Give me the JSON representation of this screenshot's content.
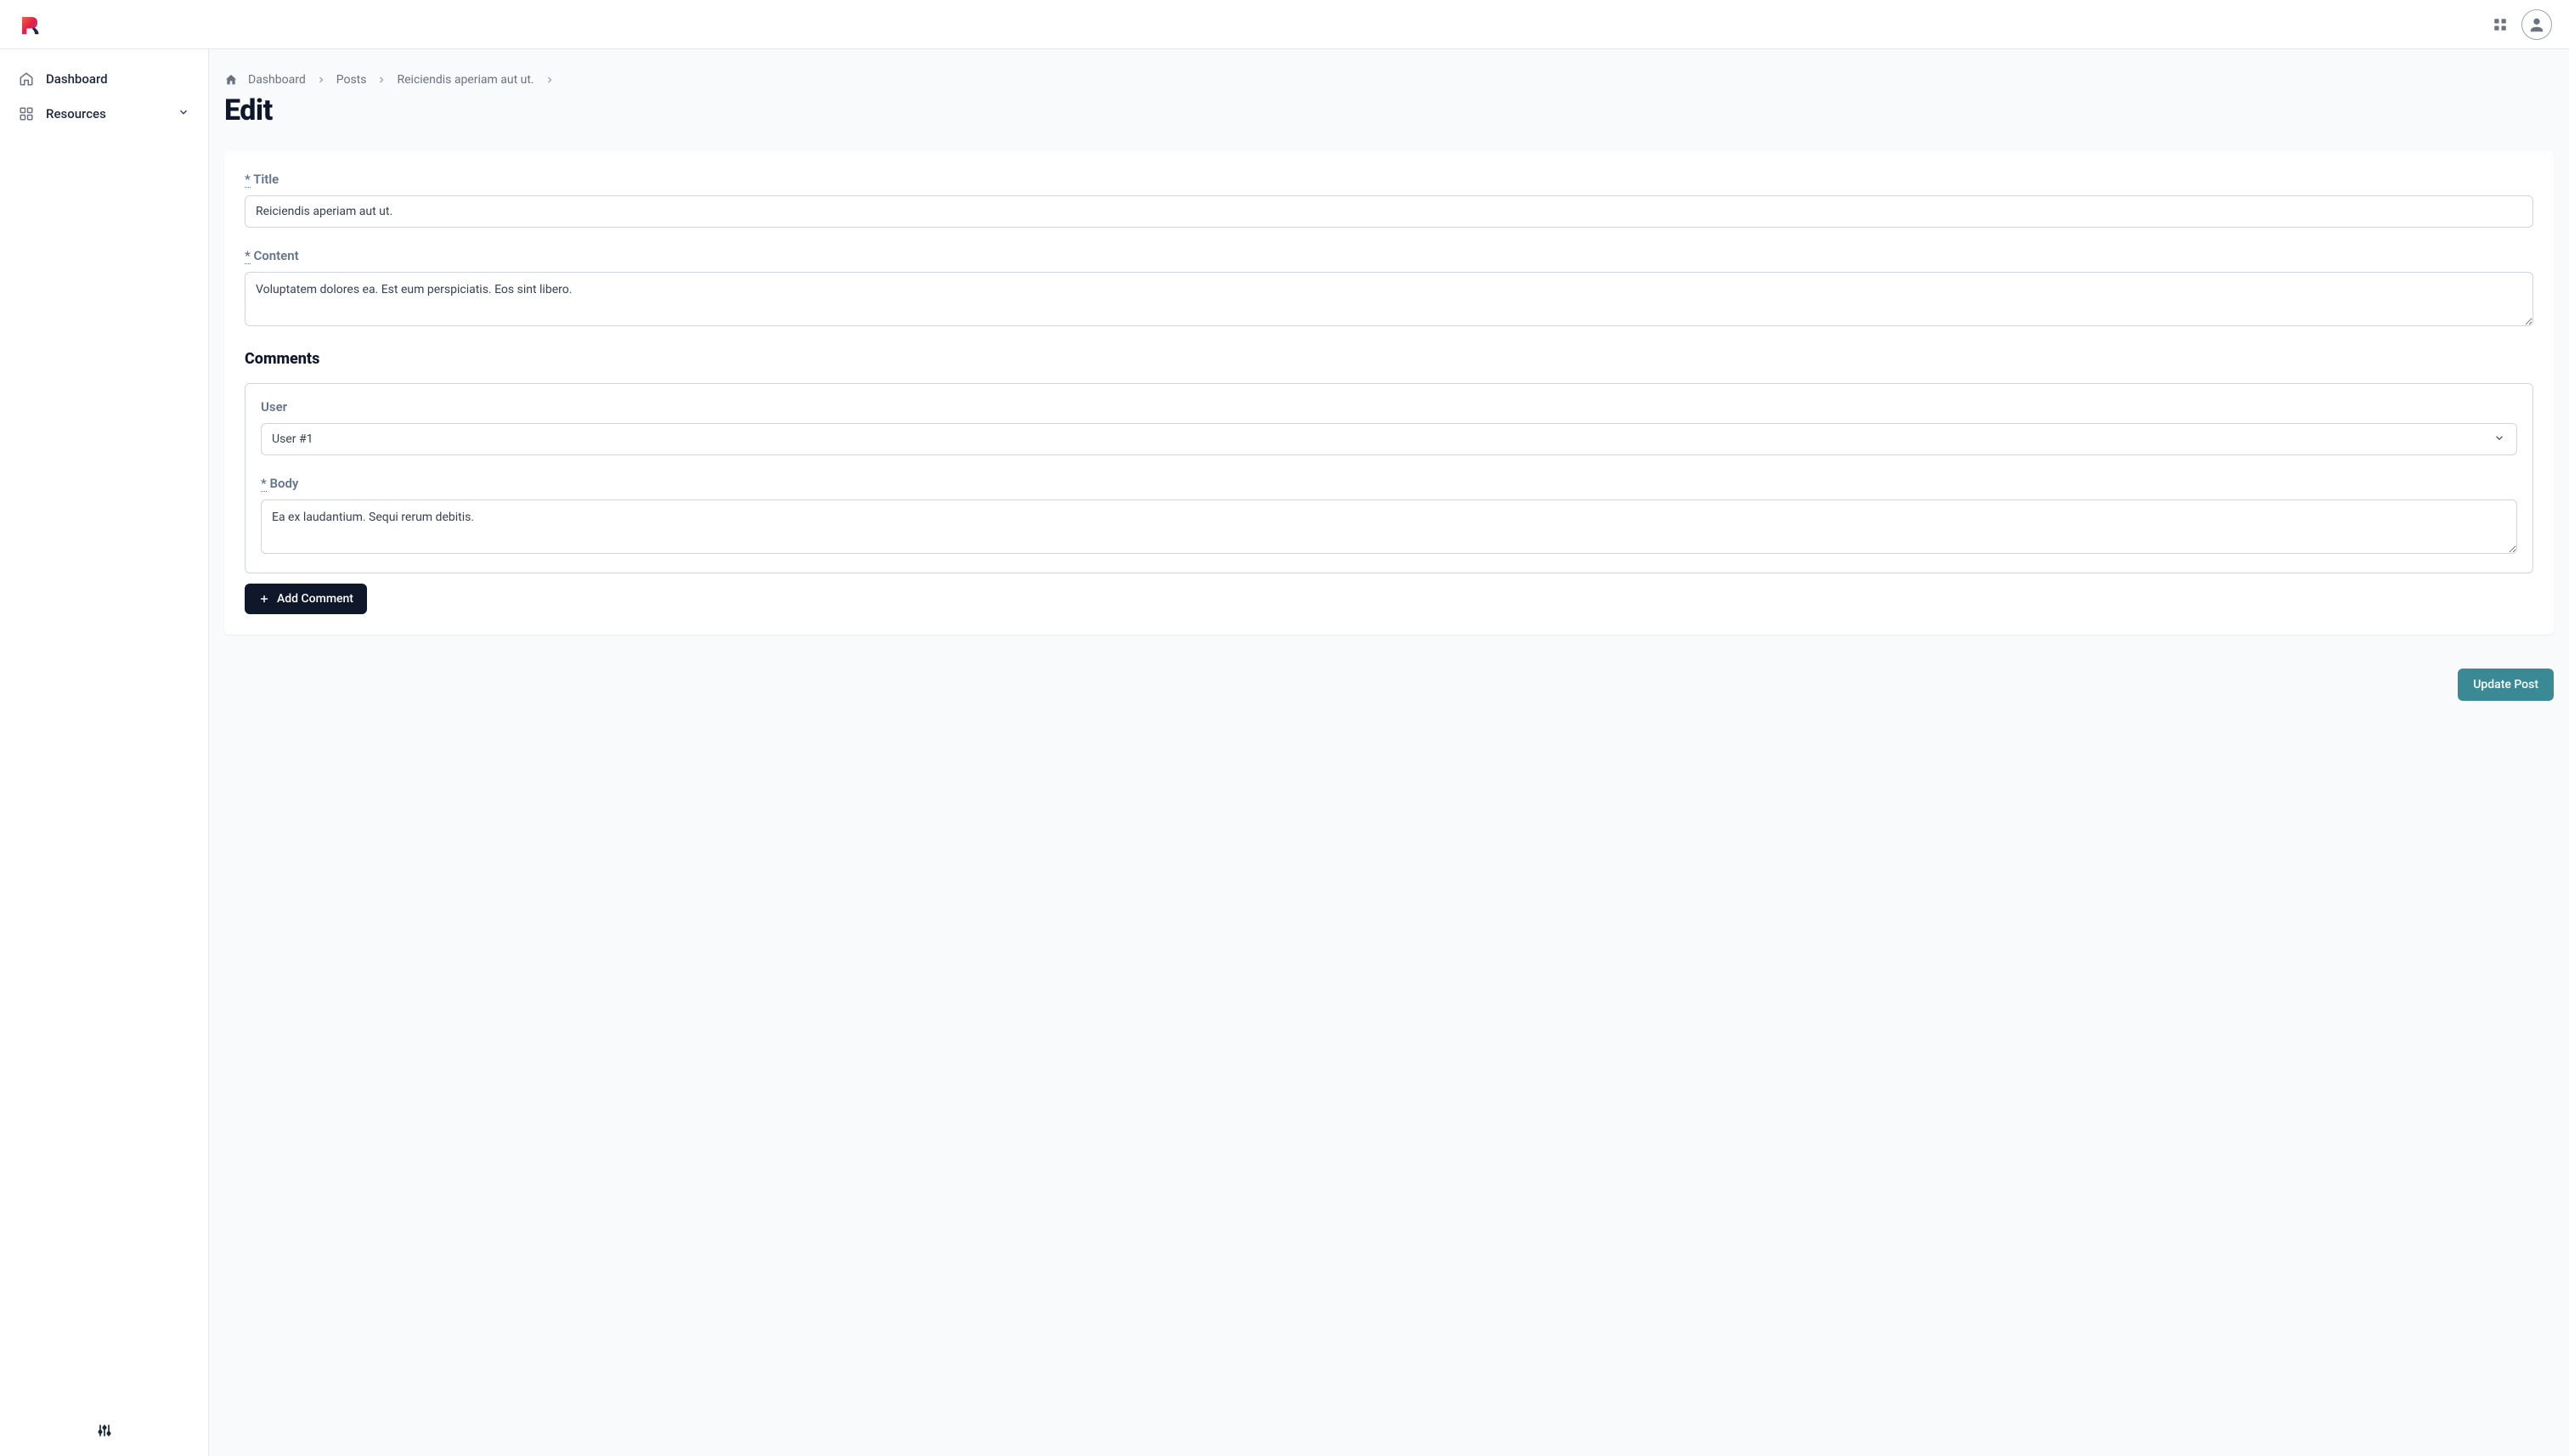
{
  "sidebar": {
    "items": [
      {
        "label": "Dashboard"
      },
      {
        "label": "Resources"
      }
    ]
  },
  "breadcrumb": {
    "items": [
      {
        "label": "Dashboard"
      },
      {
        "label": "Posts"
      },
      {
        "label": "Reiciendis aperiam aut ut."
      }
    ]
  },
  "page": {
    "title": "Edit"
  },
  "form": {
    "title_label": "Title",
    "title_value": "Reiciendis aperiam aut ut.",
    "content_label": "Content",
    "content_value": "Voluptatem dolores ea. Est eum perspiciatis. Eos sint libero.",
    "comments_heading": "Comments",
    "comment": {
      "user_label": "User",
      "user_value": "User #1",
      "body_label": "Body",
      "body_value": "Ea ex laudantium. Sequi rerum debitis."
    },
    "add_comment_label": "Add Comment",
    "submit_label": "Update Post",
    "required_marker": "*"
  }
}
